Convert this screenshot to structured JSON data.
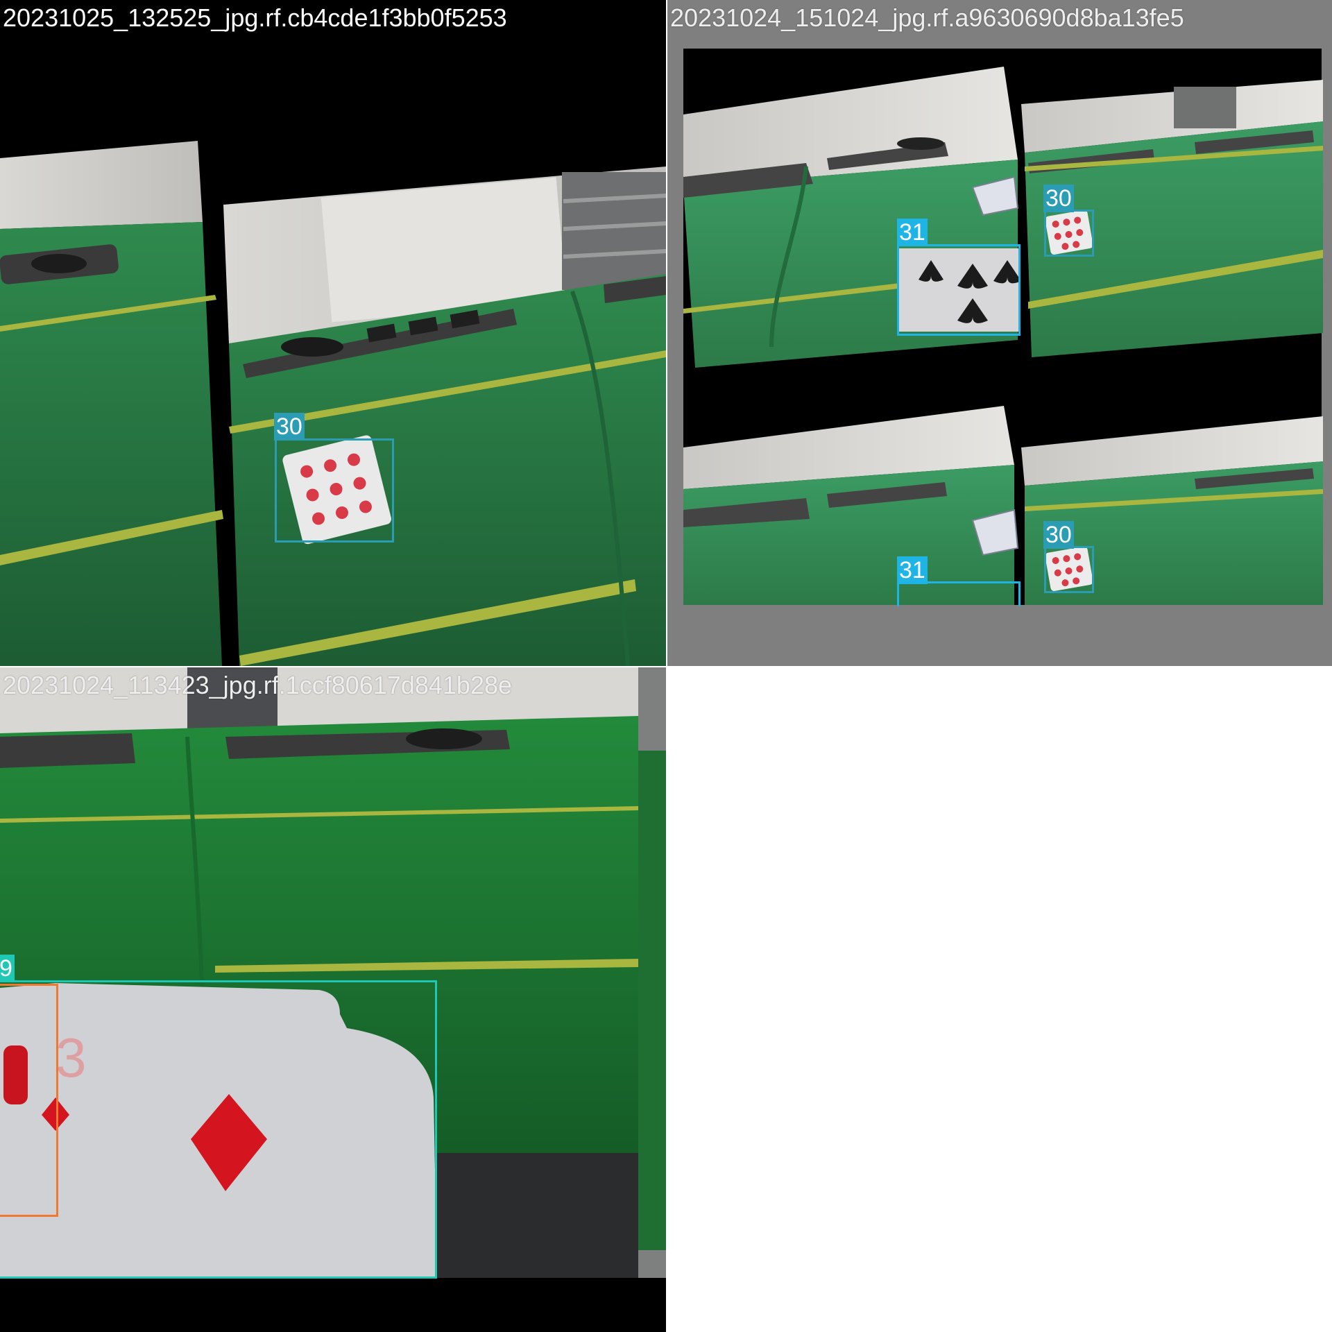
{
  "tiles": [
    {
      "title": "20231025_132525_jpg.rf.cb4cde1f3bb0f5253",
      "detections": [
        {
          "label": "30",
          "class_name": "playing-card"
        }
      ]
    },
    {
      "title": "20231024_151024_jpg.rf.a9630690d8ba13fe5",
      "detections": [
        {
          "label": "31",
          "class_name": "playing-card"
        },
        {
          "label": "30",
          "class_name": "playing-card"
        },
        {
          "label": "31",
          "class_name": "playing-card"
        },
        {
          "label": "30",
          "class_name": "playing-card"
        }
      ]
    },
    {
      "title": "20231024_113423_jpg.rf.1ccf80617d841b28e",
      "detections": [
        {
          "label": "9",
          "class_name": "playing-card"
        }
      ]
    }
  ],
  "colors": {
    "label_30": "#2a9db5",
    "label_31": "#1eb4e6",
    "label_9": "#1ec8b4",
    "box_orange": "#f07832",
    "felt": "#2e7d46",
    "mosaic_pad": "#7f7f7f"
  }
}
